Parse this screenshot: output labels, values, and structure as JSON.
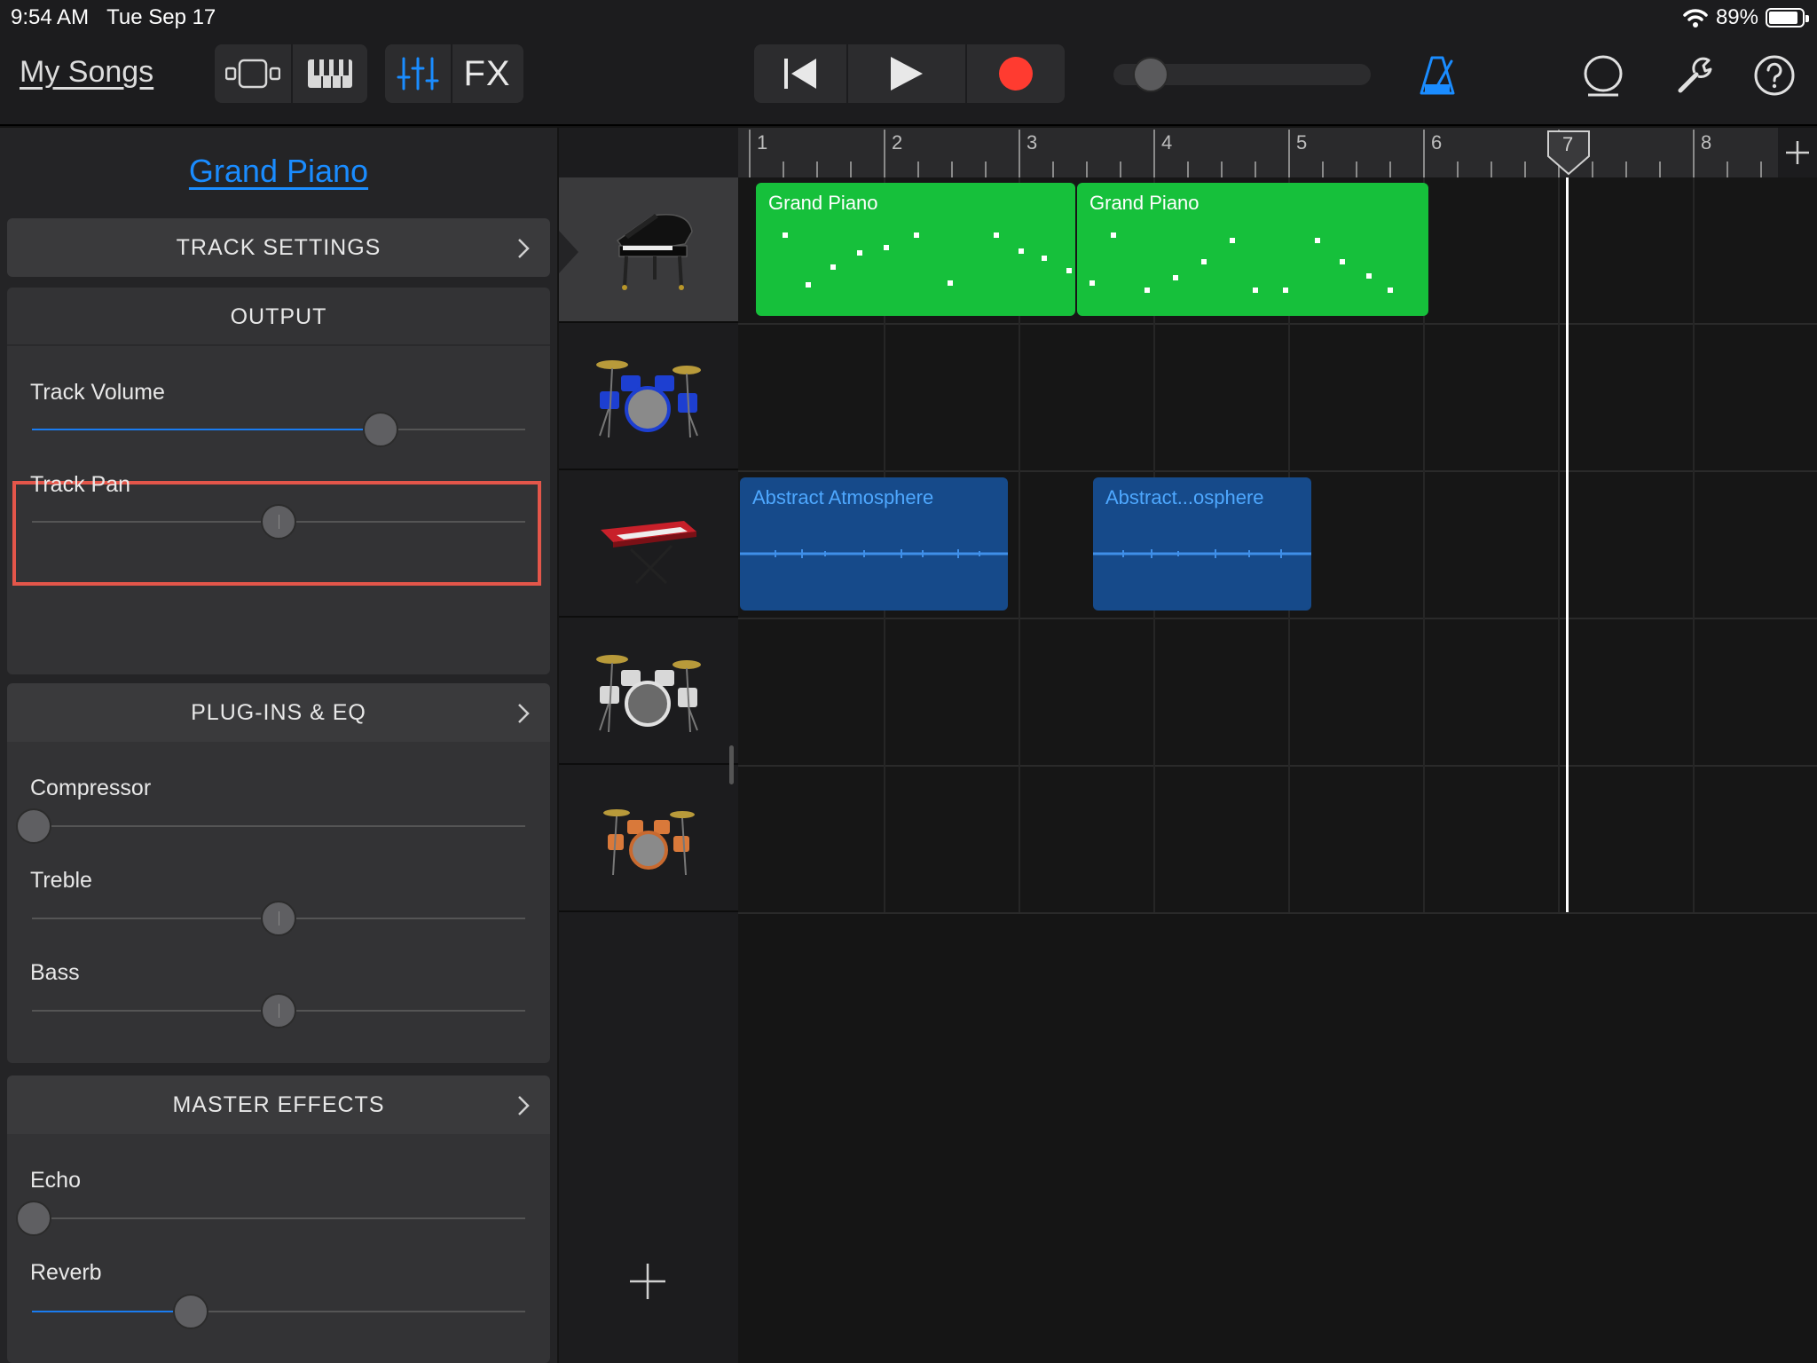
{
  "status_bar": {
    "time": "9:54 AM",
    "date": "Tue Sep 17",
    "battery": "89%",
    "battery_level": 0.89
  },
  "toolbar": {
    "my_songs": "My Songs",
    "fx_label": "FX",
    "icons": [
      "browser-view-icon",
      "keyboard-icon",
      "mixer-icon",
      "rewind-icon",
      "play-icon",
      "record-icon",
      "metronome-icon",
      "loop-icon",
      "settings-wrench-icon",
      "help-icon"
    ]
  },
  "left_panel": {
    "instrument_title": "Grand Piano",
    "track_settings": "TRACK SETTINGS",
    "output": {
      "header": "OUTPUT",
      "track_volume": {
        "label": "Track Volume",
        "value": 0.71
      },
      "track_pan": {
        "label": "Track Pan",
        "value": 0.5
      }
    },
    "plugins": {
      "header": "PLUG-INS & EQ",
      "compressor": {
        "label": "Compressor",
        "value": 0.0
      },
      "treble": {
        "label": "Treble",
        "value": 0.5
      },
      "bass": {
        "label": "Bass",
        "value": 0.5
      }
    },
    "master_effects": {
      "header": "MASTER EFFECTS",
      "echo": {
        "label": "Echo",
        "value": 0.0
      },
      "reverb": {
        "label": "Reverb",
        "value": 0.32
      }
    }
  },
  "ruler": {
    "bars": [
      "1",
      "2",
      "3",
      "4",
      "5",
      "6",
      "7",
      "8"
    ]
  },
  "tracks": [
    {
      "instrument": "grand-piano-icon",
      "regions": [
        {
          "name": "Grand Piano"
        },
        {
          "name": "Grand Piano"
        }
      ]
    },
    {
      "instrument": "blue-drum-kit-icon",
      "regions": []
    },
    {
      "instrument": "red-synth-keyboard-icon",
      "regions": [
        {
          "name": "Abstract Atmosphere"
        },
        {
          "name": "Abstract...osphere"
        }
      ]
    },
    {
      "instrument": "silver-drum-kit-icon",
      "regions": []
    },
    {
      "instrument": "orange-drum-kit-icon",
      "regions": []
    }
  ],
  "colors": {
    "accent_blue": "#1a8cff",
    "midi_region": "#16c03b",
    "audio_region": "#164a8a",
    "record_red": "#ff3b30",
    "highlight": "#e4564a"
  }
}
